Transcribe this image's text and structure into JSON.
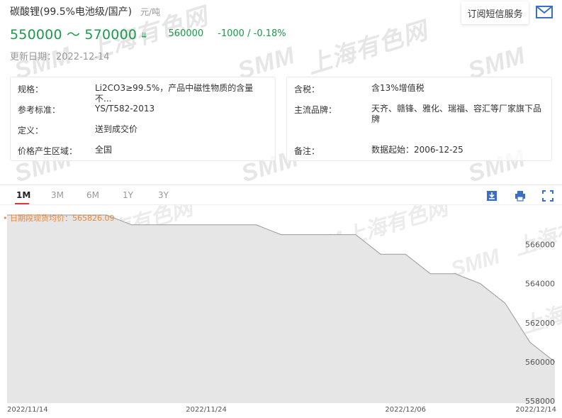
{
  "header": {
    "title": "碳酸锂(99.5%电池级/国产)",
    "unit": "元/吨",
    "price_range": "550000 ～ 570000",
    "avg_price": "560000",
    "change": "-1000",
    "change_sep": "/",
    "change_pct": "-0.18%",
    "update_date": "更新日期：2022-12-14",
    "subscribe_label": "订阅短信服务"
  },
  "info_left": [
    {
      "key": "规格：",
      "value": "Li2CO3≥99.5%，产品中磁性物质的含量不..."
    },
    {
      "key": "参考标准：",
      "value": "YS/T582-2013"
    },
    {
      "key": "定义：",
      "value": "送到成交价"
    },
    {
      "key": "价格产生区域：",
      "value": "全国"
    }
  ],
  "info_right": [
    {
      "key": "含税：",
      "value": "含13%增值税"
    },
    {
      "key": "主流品牌：",
      "value": "天齐、赣锋、雅化、瑞福、容汇等厂家旗下品牌"
    },
    {
      "key": "备注：",
      "value": "数据起始：2006-12-25"
    }
  ],
  "tabs": [
    "1M",
    "3M",
    "6M",
    "1Y",
    "3Y"
  ],
  "active_tab": "1M",
  "icons": [
    "download-icon",
    "print-icon",
    "fullscreen-icon",
    "mail-icon"
  ],
  "watermark": {
    "latin": "SMM",
    "cn": "上海有色网"
  },
  "colors": {
    "accent_green": "#1a9a4b",
    "tab_active": "#d93a3a",
    "avg_label": "#e8873a",
    "area_fill": "#e6e6e6",
    "line": "#9a9a9a"
  },
  "chart_data": {
    "type": "area",
    "annotation": "• 日期段现货均价：565826.09",
    "x": [
      "2022/11/14",
      "2022/11/15",
      "2022/11/16",
      "2022/11/17",
      "2022/11/18",
      "2022/11/21",
      "2022/11/22",
      "2022/11/23",
      "2022/11/24",
      "2022/11/25",
      "2022/11/28",
      "2022/11/29",
      "2022/11/30",
      "2022/12/01",
      "2022/12/02",
      "2022/12/05",
      "2022/12/06",
      "2022/12/07",
      "2022/12/08",
      "2022/12/09",
      "2022/12/12",
      "2022/12/13",
      "2022/12/14"
    ],
    "values": [
      567500,
      567500,
      567500,
      567500,
      567500,
      567000,
      567000,
      567000,
      567000,
      567000,
      567000,
      566500,
      566500,
      566500,
      566500,
      565500,
      565500,
      564500,
      564500,
      564000,
      563000,
      561000,
      560000
    ],
    "x_tick_labels": [
      "2022/11/14",
      "2022/11/24",
      "2022/12/06",
      "2022/12/14"
    ],
    "y_ticks": [
      558000,
      560000,
      562000,
      564000,
      566000
    ],
    "ylim": [
      557900,
      567900
    ],
    "grid": false
  }
}
